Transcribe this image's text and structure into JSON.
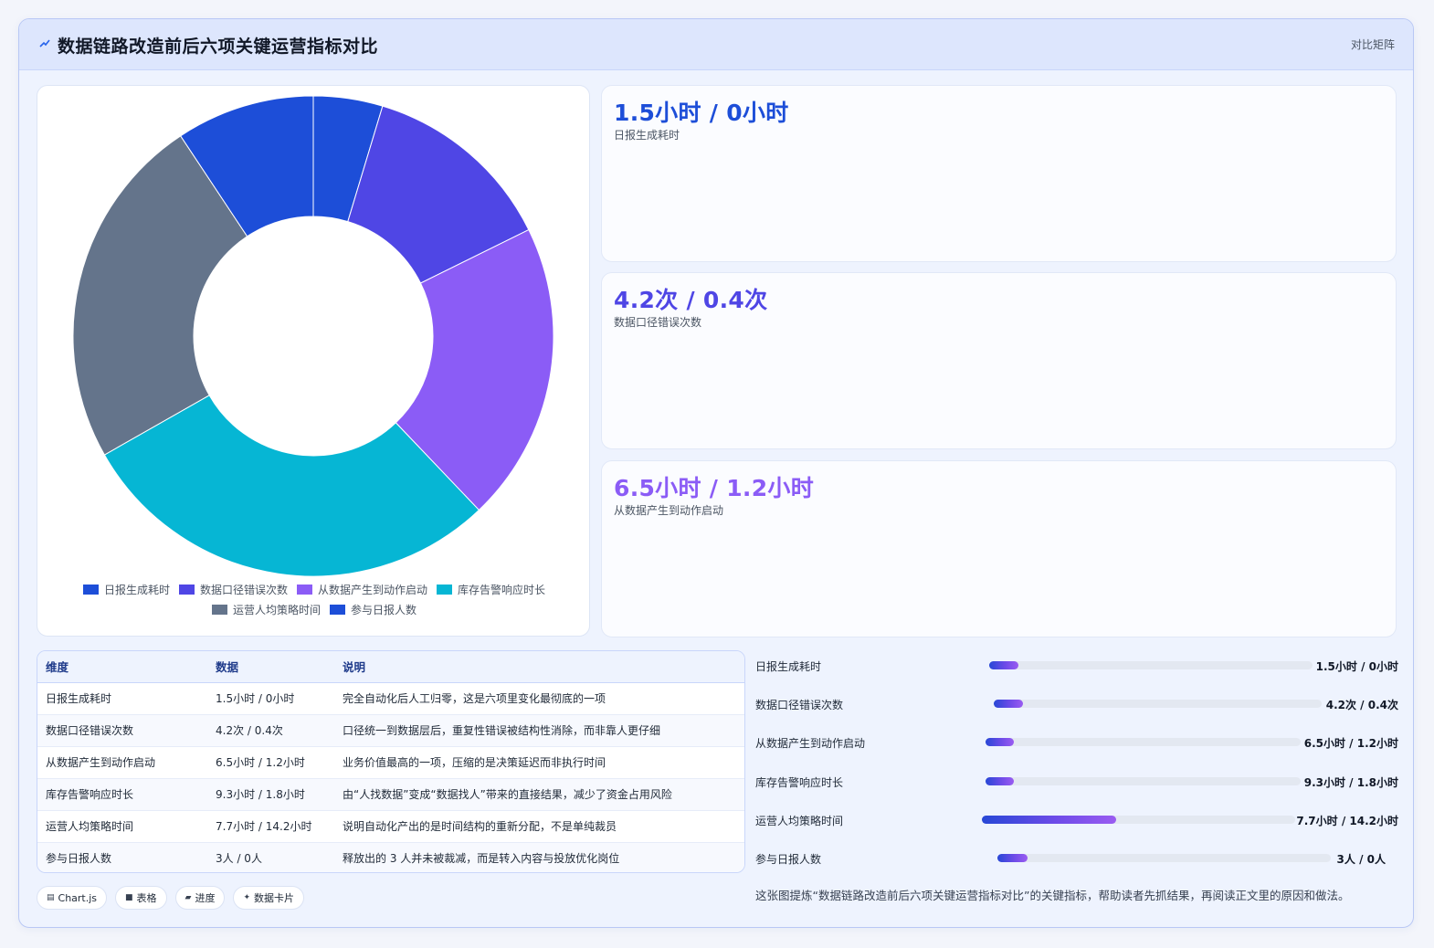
{
  "header": {
    "title": "数据链路改造前后六项关键运营指标对比",
    "view_label": "对比矩阵",
    "icon": "trend-line-icon"
  },
  "chart_data": {
    "type": "doughnut",
    "categories": [
      "日报生成耗时",
      "数据口径错误次数",
      "从数据产生到动作启动",
      "库存告警响应时长",
      "运营人均策略时间",
      "参与日报人数"
    ],
    "values": [
      1.5,
      4.2,
      6.5,
      9.3,
      7.7,
      3
    ],
    "colors": [
      "#1d4ed8",
      "#4f46e5",
      "#8b5cf6",
      "#06b6d4",
      "#64748b",
      "#1d4ed8"
    ],
    "legend_position": "bottom"
  },
  "kpis": [
    {
      "value": "1.5小时 / 0小时",
      "label": "日报生成耗时",
      "color": "#1d4ed8"
    },
    {
      "value": "4.2次 / 0.4次",
      "label": "数据口径错误次数",
      "color": "#4f46e5"
    },
    {
      "value": "6.5小时 / 1.2小时",
      "label": "从数据产生到动作启动",
      "color": "#8b5cf6"
    }
  ],
  "table": {
    "headers": [
      "维度",
      "数据",
      "说明"
    ],
    "rows": [
      [
        "日报生成耗时",
        "1.5小时 / 0小时",
        "完全自动化后人工归零，这是六项里变化最彻底的一项"
      ],
      [
        "数据口径错误次数",
        "4.2次 / 0.4次",
        "口径统一到数据层后，重复性错误被结构性消除，而非靠人更仔细"
      ],
      [
        "从数据产生到动作启动",
        "6.5小时 / 1.2小时",
        "业务价值最高的一项，压缩的是决策延迟而非执行时间"
      ],
      [
        "库存告警响应时长",
        "9.3小时 / 1.8小时",
        "由“人找数据”变成“数据找人”带来的直接结果，减少了资金占用风险"
      ],
      [
        "运营人均策略时间",
        "7.7小时 / 14.2小时",
        "说明自动化产出的是时间结构的重新分配，不是单纯裁员"
      ],
      [
        "参与日报人数",
        "3人 / 0人",
        "释放出的 3 人并未被裁减，而是转入内容与投放优化岗位"
      ]
    ]
  },
  "chips": [
    {
      "icon": "▤",
      "label": "Chart.js"
    },
    {
      "icon": "■",
      "label": "表格"
    },
    {
      "icon": "▰",
      "label": "进度"
    },
    {
      "icon": "✦",
      "label": "数据卡片"
    }
  ],
  "bars": [
    {
      "label": "日报生成耗时",
      "value": "1.5小时 / 0小时",
      "fill": 0.09
    },
    {
      "label": "数据口径错误次数",
      "value": "4.2次 / 0.4次",
      "fill": 0.09
    },
    {
      "label": "从数据产生到动作启动",
      "value": "6.5小时 / 1.2小时",
      "fill": 0.09
    },
    {
      "label": "库存告警响应时长",
      "value": "9.3小时 / 1.8小时",
      "fill": 0.09
    },
    {
      "label": "运营人均策略时间",
      "value": "7.7小时 / 14.2小时",
      "fill": 0.43
    },
    {
      "label": "参与日报人数",
      "value": "3人 / 0人",
      "fill": 0.09
    }
  ],
  "caption": "这张图提炼“数据链路改造前后六项关键运营指标对比”的关键指标，帮助读者先抓结果，再阅读正文里的原因和做法。"
}
